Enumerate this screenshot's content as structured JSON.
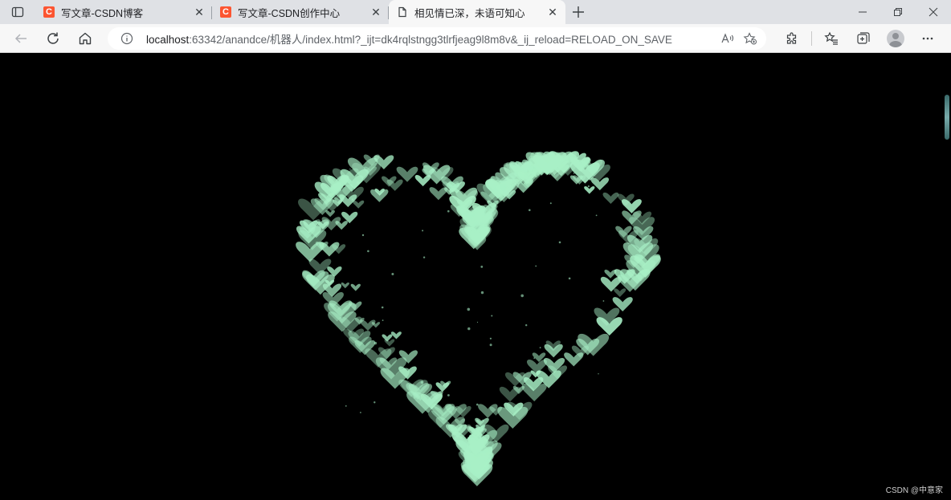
{
  "tabs": [
    {
      "title": "写文章-CSDN博客",
      "icon": "csdn-icon",
      "active": false
    },
    {
      "title": "写文章-CSDN创作中心",
      "icon": "csdn-icon",
      "active": false
    },
    {
      "title": "相见情已深，未语可知心",
      "icon": "document-icon",
      "active": true
    }
  ],
  "csdn_glyph": "C",
  "address_bar": {
    "host": "localhost",
    "rest": ":63342/anandce/机器人/index.html?_ijt=dk4rqlstngg3tlrfjeag9l8m8v&_ij_reload=RELOAD_ON_SAVE"
  },
  "content": {
    "background": "#000000",
    "heart_color": "#a8f0c6",
    "watermark": "CSDN @中意家"
  },
  "colors": {
    "tabstrip": "#dfe1e5",
    "toolbar": "#f7f7f7",
    "csdn_brand": "#fc5531"
  }
}
